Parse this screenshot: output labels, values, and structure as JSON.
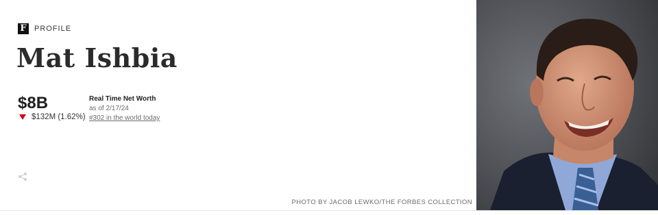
{
  "profile": {
    "tag_logo": "F",
    "tag_label": "PROFILE",
    "name": "Mat Ishbia"
  },
  "net_worth": {
    "value": "$8B",
    "change": "$132M (1.62%)",
    "change_direction": "down",
    "label": "Real Time Net Worth",
    "as_of": "as of 2/17/24",
    "rank": "#302 in the world today"
  },
  "photo": {
    "credit": "PHOTO BY JACOB LEWKO/THE FORBES COLLECTION"
  },
  "icons": {
    "share": "share-icon",
    "change_arrow": "triangle-down-icon"
  },
  "colors": {
    "down": "#d0021b",
    "text": "#1f1f1f",
    "muted": "#6b6b6b"
  }
}
